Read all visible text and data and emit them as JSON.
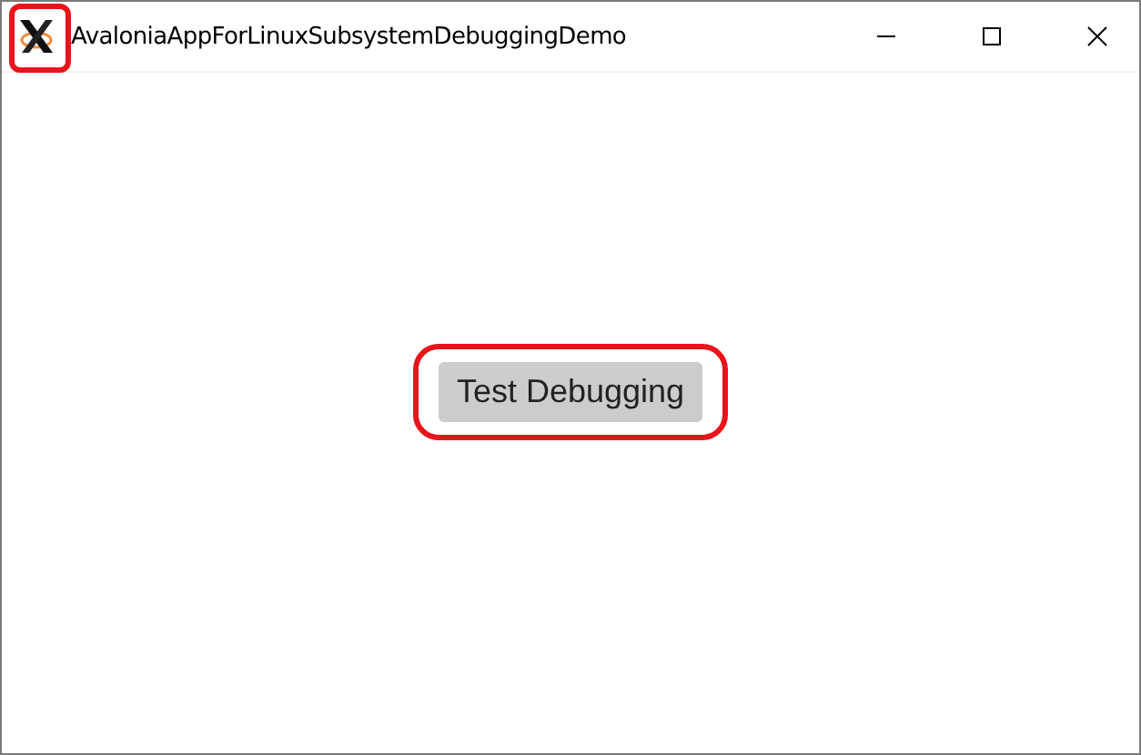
{
  "window": {
    "title": "AvaloniaAppForLinuxSubsystemDebuggingDemo"
  },
  "content": {
    "button": {
      "label": "Test Debugging",
      "highlighted": true
    },
    "icon_highlighted": true
  }
}
